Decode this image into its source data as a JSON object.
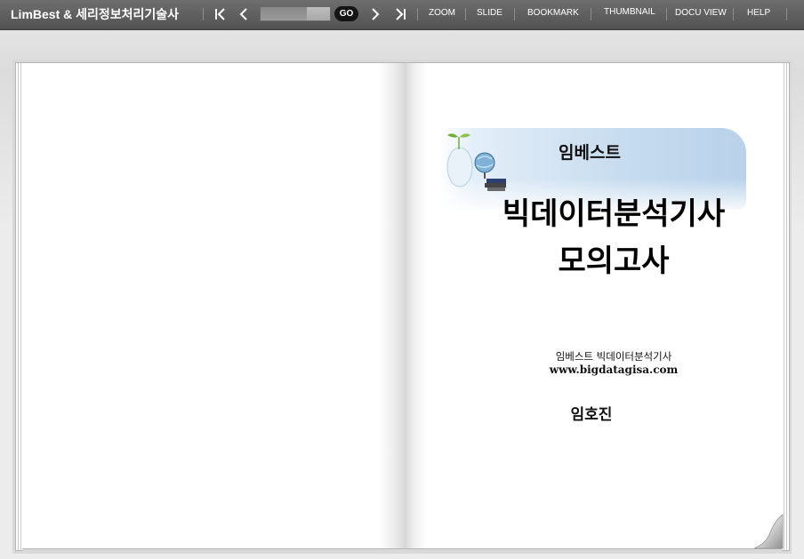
{
  "toolbar": {
    "title": "LimBest & 세리정보처리기술사",
    "page_input_value": "",
    "go_label": "GO",
    "menu": [
      "ZOOM",
      "SLIDE",
      "BOOKMARK",
      "THUMBNAIL",
      "DOCU VIEW",
      "HELP"
    ],
    "icons": [
      "first-page-icon",
      "previous-page-icon",
      "next-page-icon",
      "last-page-icon"
    ]
  },
  "cover": {
    "brand": "임베스트",
    "title_line1": "빅데이터분석기사",
    "title_line2": "모의고사",
    "subtitle": "임베스트  빅데이터분석기사",
    "website": "www.bigdatagisa.com",
    "author": "임호진"
  },
  "colors": {
    "toolbar_bg": "#5e5e5e",
    "banner_blue": "#b9d2ea",
    "background": "#e6e6e6"
  }
}
